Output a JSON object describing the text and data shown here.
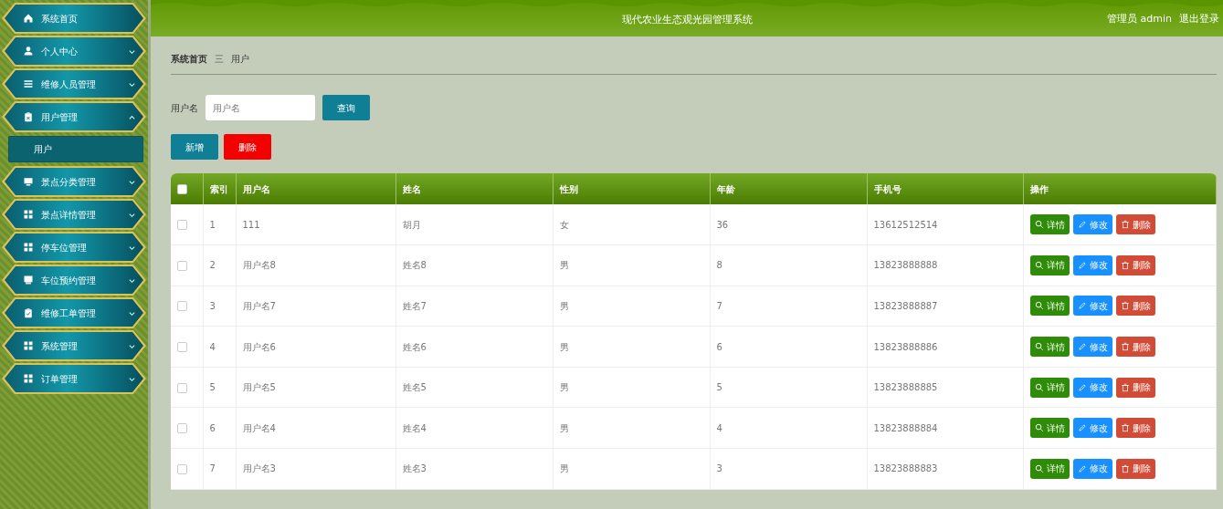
{
  "header": {
    "title": "现代农业生态观光园管理系统",
    "user": "管理员 admin",
    "logout": "退出登录"
  },
  "sidebar": {
    "items": [
      {
        "label": "系统首页",
        "kind": "link"
      },
      {
        "label": "个人中心",
        "kind": "menu",
        "expanded": false
      },
      {
        "label": "维修人员管理",
        "kind": "menu",
        "expanded": false
      },
      {
        "label": "用户管理",
        "kind": "menu",
        "expanded": true,
        "children": [
          {
            "label": "用户",
            "selected": true
          }
        ]
      },
      {
        "label": "景点分类管理",
        "kind": "menu",
        "expanded": false
      },
      {
        "label": "景点详情管理",
        "kind": "menu",
        "expanded": false
      },
      {
        "label": "停车位管理",
        "kind": "menu",
        "expanded": false
      },
      {
        "label": "车位预约管理",
        "kind": "menu",
        "expanded": false
      },
      {
        "label": "维修工单管理",
        "kind": "menu",
        "expanded": false
      },
      {
        "label": "系统管理",
        "kind": "menu",
        "expanded": false
      },
      {
        "label": "订单管理",
        "kind": "menu",
        "expanded": false
      }
    ]
  },
  "breadcrumb": [
    "系统首页",
    "用户"
  ],
  "breadcrumb_separator": "三",
  "search": {
    "label": "用户名",
    "placeholder": "用户名",
    "button": "查询"
  },
  "actions": {
    "add": "新增",
    "delete": "删除"
  },
  "table": {
    "all_checked": false,
    "columns": [
      "索引",
      "用户名",
      "姓名",
      "性别",
      "年龄",
      "手机号",
      "操作"
    ],
    "rows": [
      {
        "checked": false,
        "cells": [
          "1",
          "111",
          "胡月",
          "女",
          "36",
          "13612512514"
        ],
        "buttons": [
          "详情",
          "修改",
          "删除"
        ]
      },
      {
        "checked": false,
        "cells": [
          "2",
          "用户名8",
          "姓名8",
          "男",
          "8",
          "13823888888"
        ],
        "buttons": [
          "详情",
          "修改",
          "删除"
        ]
      },
      {
        "checked": false,
        "cells": [
          "3",
          "用户名7",
          "姓名7",
          "男",
          "7",
          "13823888887"
        ],
        "buttons": [
          "详情",
          "修改",
          "删除"
        ]
      },
      {
        "checked": false,
        "cells": [
          "4",
          "用户名6",
          "姓名6",
          "男",
          "6",
          "13823888886"
        ],
        "buttons": [
          "详情",
          "修改",
          "删除"
        ]
      },
      {
        "checked": false,
        "cells": [
          "5",
          "用户名5",
          "姓名5",
          "男",
          "5",
          "13823888885"
        ],
        "buttons": [
          "详情",
          "修改",
          "删除"
        ]
      },
      {
        "checked": false,
        "cells": [
          "6",
          "用户名4",
          "姓名4",
          "男",
          "4",
          "13823888884"
        ],
        "buttons": [
          "详情",
          "修改",
          "删除"
        ]
      },
      {
        "checked": false,
        "cells": [
          "7",
          "用户名3",
          "姓名3",
          "男",
          "3",
          "13823888883"
        ],
        "buttons": [
          "详情",
          "修改",
          "删除"
        ]
      }
    ]
  }
}
